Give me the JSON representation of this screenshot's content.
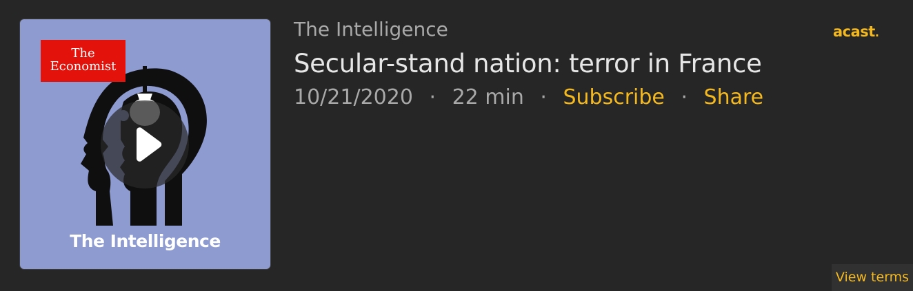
{
  "show": {
    "name": "The Intelligence"
  },
  "episode": {
    "title": "Secular-stand nation: terror in France",
    "date": "10/21/2020",
    "duration": "22 min",
    "separator": "·"
  },
  "actions": {
    "subscribe": "Subscribe",
    "share": "Share",
    "view_terms": "View terms"
  },
  "cover": {
    "logo_line1": "The",
    "logo_line2": "Economist",
    "title": "The Intelligence",
    "play_icon": "play-icon"
  },
  "branding": {
    "provider_logo": "acast",
    "provider_dot": "."
  },
  "colors": {
    "background": "#262626",
    "accent": "#f5b920",
    "cover_background": "#8e9bd0",
    "logo_red": "#e3120b",
    "title_text": "#e6e6e6",
    "meta_text": "#a9a9a9"
  }
}
